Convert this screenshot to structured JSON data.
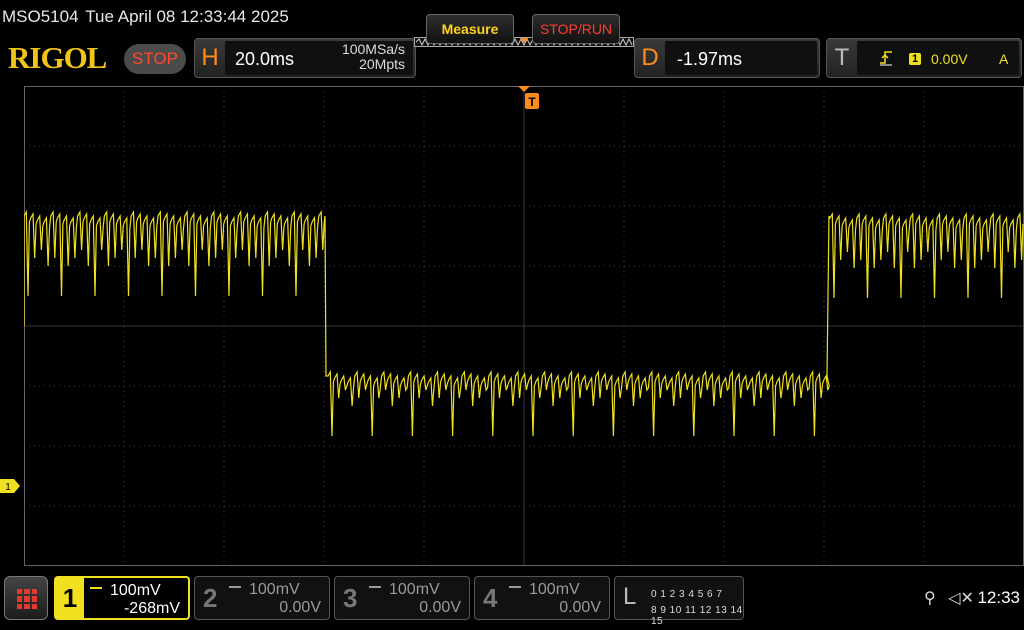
{
  "titlebar": {
    "model": "MSO5104",
    "datetime": "Tue April 08 12:33:44 2025"
  },
  "header": {
    "logo": "RIGOL",
    "run_state": "STOP",
    "horizontal": {
      "tag": "H",
      "timebase": "20.0ms",
      "sample_rate": "100MSa/s",
      "memory_depth": "20Mpts"
    },
    "measure_label": "Measure",
    "stoprun_label": "STOP/RUN",
    "delay": {
      "tag": "D",
      "value": "-1.97ms"
    },
    "trigger": {
      "tag": "T",
      "source": "1",
      "level": "0.00V",
      "mode": "A"
    }
  },
  "channels": [
    {
      "num": "1",
      "scale": "100mV",
      "offset": "-268mV",
      "active": true,
      "color": "#f0e020"
    },
    {
      "num": "2",
      "scale": "100mV",
      "offset": "0.00V",
      "active": false
    },
    {
      "num": "3",
      "scale": "100mV",
      "offset": "0.00V",
      "active": false
    },
    {
      "num": "4",
      "scale": "100mV",
      "offset": "0.00V",
      "active": false
    }
  ],
  "logic": {
    "label": "L",
    "row1": "0 1 2 3   4 5 6 7",
    "row2": "8 9 10 11 12 13 14 15"
  },
  "status": {
    "time": "12:33"
  },
  "ch1_marker": "1",
  "colors": {
    "trace": "#f0e020",
    "accent": "#ff8c1a",
    "grid": "#444444"
  },
  "icons": {
    "usb": "usb-icon",
    "sound": "speaker-muted-icon",
    "menu": "main-menu-icon",
    "trigger_edge": "rising-edge-icon"
  }
}
